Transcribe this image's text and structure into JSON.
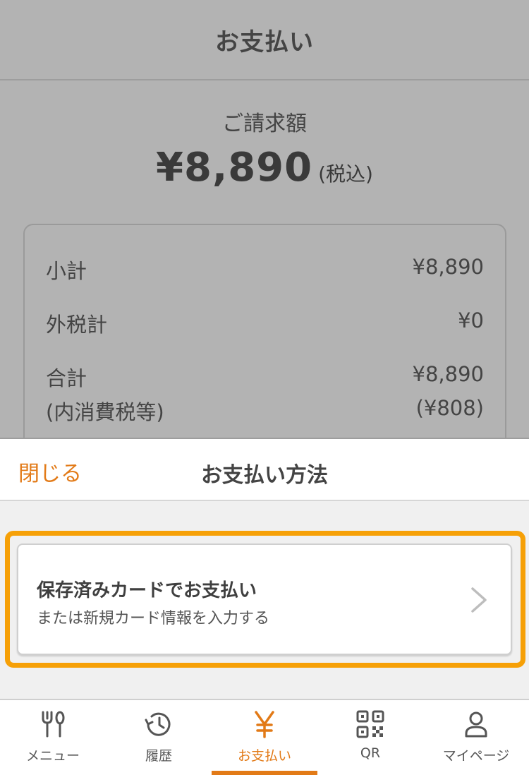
{
  "page": {
    "title": "お支払い",
    "billing_label": "ご請求額",
    "billing_amount": "¥8,890",
    "tax_note": "(税込)"
  },
  "summary": {
    "subtotal_label": "小計",
    "subtotal_value": "¥8,890",
    "ext_tax_label": "外税計",
    "ext_tax_value": "¥0",
    "total_label": "合計",
    "total_value": "¥8,890",
    "inner_tax_label": "(内消費税等)",
    "inner_tax_value": "(¥808)"
  },
  "sheet": {
    "close_label": "閉じる",
    "title": "お支払い方法",
    "option": {
      "title": "保存済みカードでお支払い",
      "subtitle": "または新規カード情報を入力する"
    }
  },
  "tabs": [
    {
      "label": "メニュー",
      "icon": "fork-knife-icon"
    },
    {
      "label": "履歴",
      "icon": "history-icon"
    },
    {
      "label": "お支払い",
      "icon": "yen-icon",
      "active": true
    },
    {
      "label": "QR",
      "icon": "qr-icon"
    },
    {
      "label": "マイページ",
      "icon": "user-icon"
    }
  ],
  "colors": {
    "accent": "#e27a17",
    "highlight": "#f6a007",
    "overlay": "#b3b3b3"
  }
}
